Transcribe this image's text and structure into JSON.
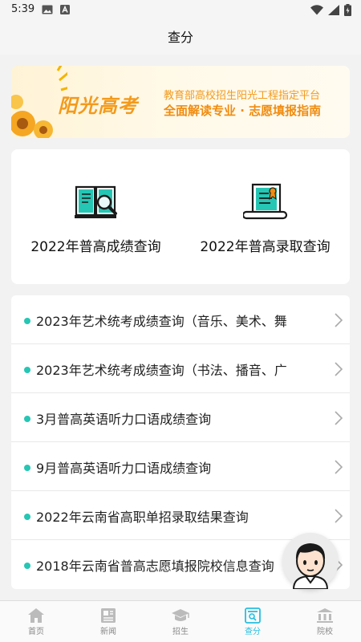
{
  "status_bar": {
    "time": "5:39"
  },
  "header": {
    "title": "查分"
  },
  "banner": {
    "logo_text": "阳光高考",
    "line1": "教育部高校招生阳光工程指定平台",
    "line2": "全面解读专业 · 志愿填报指南"
  },
  "quick_links": [
    {
      "label": "2022年普高成绩查询",
      "icon": "book-magnifier-icon"
    },
    {
      "label": "2022年普高录取查询",
      "icon": "certificate-scroll-icon"
    }
  ],
  "list": [
    {
      "text": "2023年艺术统考成绩查询（音乐、美术、舞"
    },
    {
      "text": "2023年艺术统考成绩查询（书法、播音、广"
    },
    {
      "text": "3月普高英语听力口语成绩查询"
    },
    {
      "text": "9月普高英语听力口语成绩查询"
    },
    {
      "text": "2022年云南省高职单招录取结果查询"
    },
    {
      "text": "2018年云南省普高志愿填报院校信息查询"
    }
  ],
  "nav": [
    {
      "label": "首页",
      "icon": "home-icon"
    },
    {
      "label": "新闻",
      "icon": "news-icon"
    },
    {
      "label": "招生",
      "icon": "graduation-cap-icon"
    },
    {
      "label": "查分",
      "icon": "score-search-icon",
      "active": true
    },
    {
      "label": "院校",
      "icon": "university-icon"
    }
  ],
  "colors": {
    "accent": "#26bfe0",
    "dot": "#26c6b4",
    "banner_orange": "#f39a1c"
  }
}
